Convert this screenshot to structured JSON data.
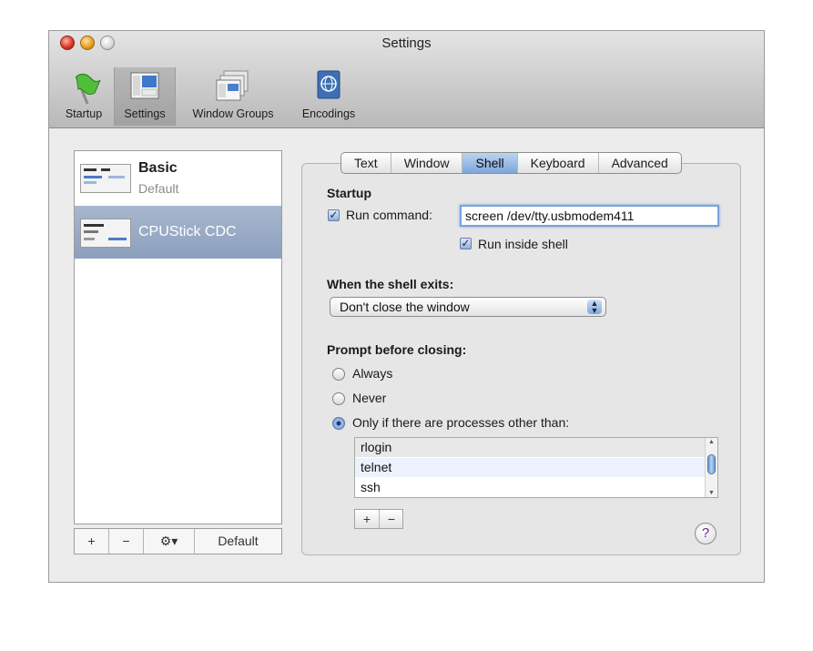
{
  "window": {
    "title": "Settings"
  },
  "toolbar": {
    "items": [
      {
        "label": "Startup",
        "icon": "flag-icon"
      },
      {
        "label": "Settings",
        "icon": "settings-icon",
        "selected": true
      },
      {
        "label": "Window Groups",
        "icon": "window-groups-icon"
      },
      {
        "label": "Encodings",
        "icon": "globe-icon"
      }
    ]
  },
  "profiles": [
    {
      "name": "Basic",
      "subtitle": "Default",
      "selected": false
    },
    {
      "name": "CPUStick CDC",
      "subtitle": "",
      "selected": true
    }
  ],
  "profile_actions": {
    "add": "+",
    "remove": "−",
    "gear": "⚙▾",
    "default_label": "Default"
  },
  "tabs": [
    {
      "label": "Text",
      "active": false
    },
    {
      "label": "Window",
      "active": false
    },
    {
      "label": "Shell",
      "active": true
    },
    {
      "label": "Keyboard",
      "active": false
    },
    {
      "label": "Advanced",
      "active": false
    }
  ],
  "shell": {
    "startup_heading": "Startup",
    "run_command_label": "Run command:",
    "run_command_checked": true,
    "run_command_value": "screen /dev/tty.usbmodem411",
    "run_inside_shell_label": "Run inside shell",
    "run_inside_shell_checked": true,
    "exit_heading": "When the shell exits:",
    "exit_selected": "Don't close the window",
    "prompt_heading": "Prompt before closing:",
    "prompt_options": [
      {
        "label": "Always",
        "selected": false
      },
      {
        "label": "Never",
        "selected": false
      },
      {
        "label": "Only if there are processes other than:",
        "selected": true
      }
    ],
    "processes": [
      "rlogin",
      "telnet",
      "ssh"
    ],
    "add": "+",
    "remove": "−",
    "help": "?"
  },
  "colors": {
    "selection": "#8c9fbd",
    "accent": "#7aa2dc"
  }
}
